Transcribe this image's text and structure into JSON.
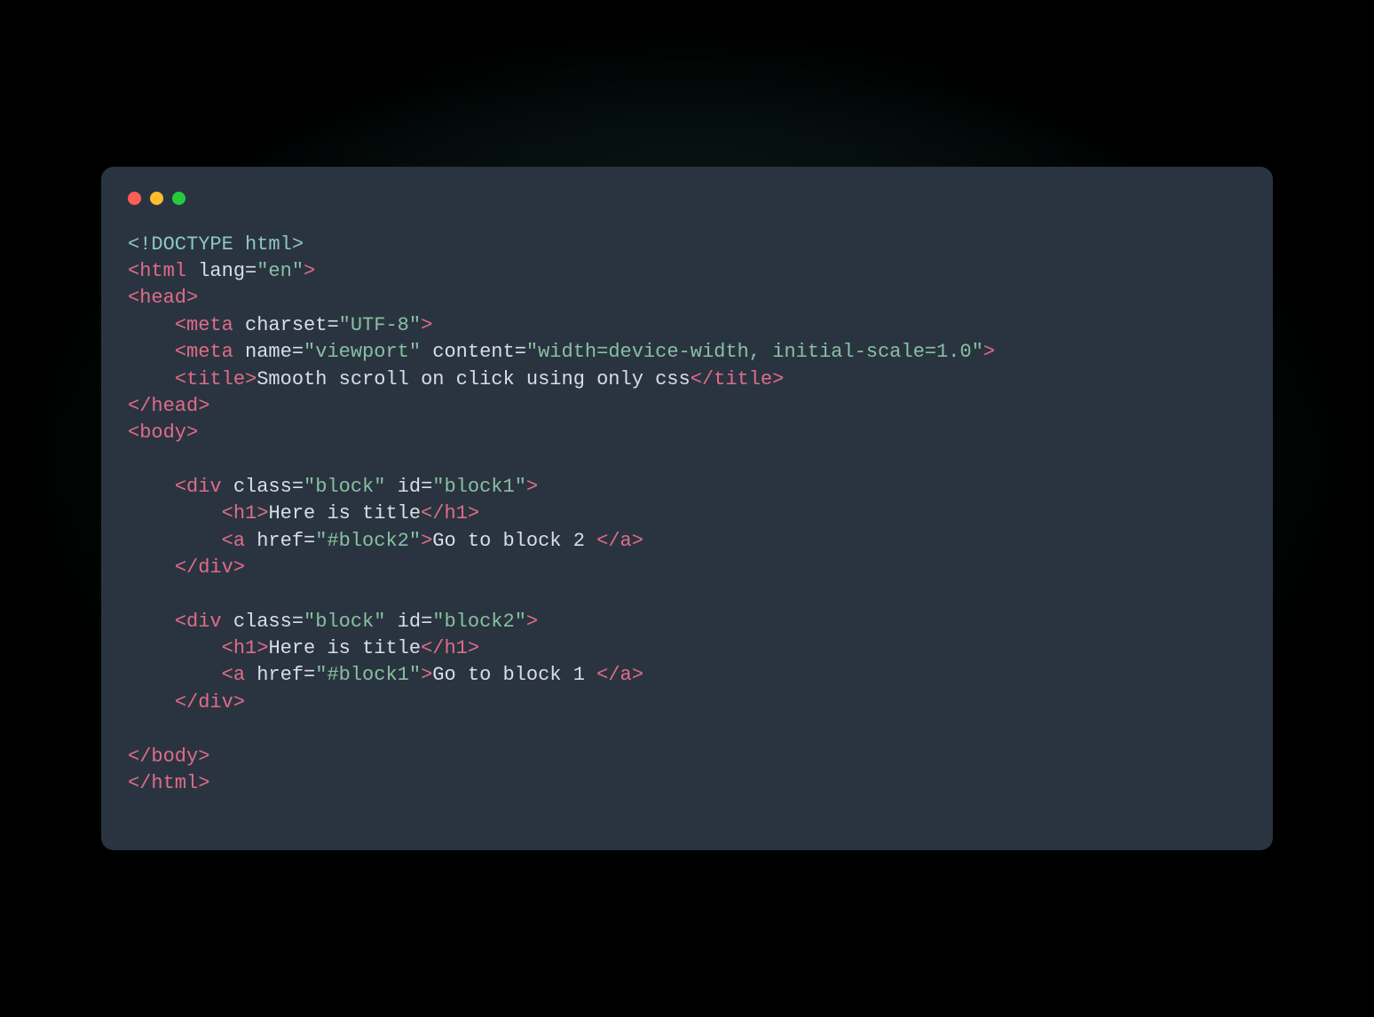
{
  "window": {
    "traffic_lights": {
      "red": "#ff5f56",
      "yellow": "#ffbd2e",
      "green": "#27c93f"
    }
  },
  "code": {
    "doctype": "<!DOCTYPE html>",
    "html_open": "<html",
    "lang_attr": "lang",
    "lang_val": "\"en\"",
    "head_open": "<head>",
    "meta1_open": "<meta",
    "charset_attr": "charset",
    "charset_val": "\"UTF-8\"",
    "meta2_open": "<meta",
    "name_attr": "name",
    "name_val": "\"viewport\"",
    "content_attr": "content",
    "content_val": "\"width=device-width, initial-scale=1.0\"",
    "title_open": "<title>",
    "title_text": "Smooth scroll on click using only css",
    "title_close": "</title>",
    "head_close": "</head>",
    "body_open": "<body>",
    "div_open": "<div",
    "class_attr": "class",
    "class_val": "\"block\"",
    "id_attr": "id",
    "id_val1": "\"block1\"",
    "id_val2": "\"block2\"",
    "h1_open": "<h1>",
    "h1_text": "Here is title",
    "h1_close": "</h1>",
    "a_open": "<a",
    "href_attr": "href",
    "href_val1": "\"#block2\"",
    "href_val2": "\"#block1\"",
    "a_text1": "Go to block 2 ",
    "a_text2": "Go to block 1 ",
    "a_close": "</a>",
    "div_close": "</div>",
    "body_close": "</body>",
    "html_close": "</html>",
    "gt": ">",
    "eq": "="
  }
}
